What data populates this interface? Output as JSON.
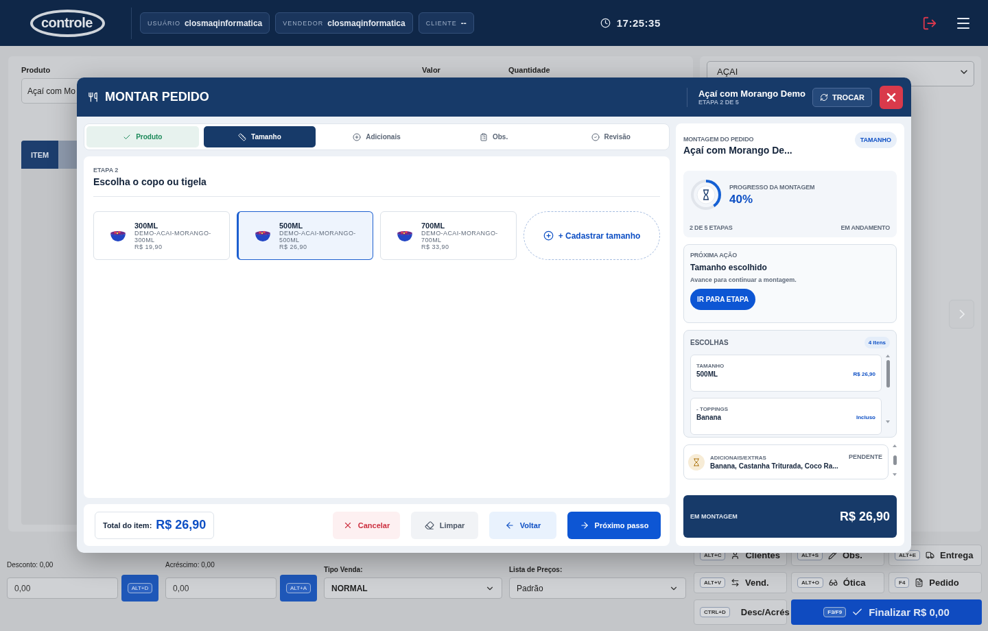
{
  "header": {
    "logo": "controle",
    "chips": [
      {
        "label": "USUÁRIO",
        "value": "closmaqinformatica"
      },
      {
        "label": "VENDEDOR",
        "value": "closmaqinformatica"
      },
      {
        "label": "CLIENTE",
        "value": "--"
      }
    ],
    "clock": "17:25:35"
  },
  "product_form": {
    "product_label": "Produto",
    "product_value": "Açaí com Mo",
    "price_label": "Valor",
    "quantity_label": "Quantidade",
    "table": {
      "columns": [
        "ITEM"
      ]
    }
  },
  "category_select": {
    "value": "AÇAI"
  },
  "bottom": {
    "discount": {
      "label": "Desconto: 0,00",
      "value": "0,00",
      "shortcut": "ALT+D"
    },
    "surcharge": {
      "label": "Acréscimo: 0,00",
      "value": "0,00",
      "shortcut": "ALT+A"
    },
    "sale_type": {
      "label": "Tipo Venda:",
      "value": "NORMAL"
    },
    "price_list": {
      "label": "Lista de Preços:",
      "value": "Padrão"
    },
    "actions": [
      {
        "key": "ALT+C",
        "label": "Clientes",
        "kind": "normal"
      },
      {
        "key": "ALT+S",
        "label": "Obs.",
        "kind": "normal"
      },
      {
        "key": "ALT+E",
        "label": "Entrega",
        "kind": "normal"
      },
      {
        "key": "ALT+V",
        "label": "Vend.",
        "kind": "normal"
      },
      {
        "key": "ALT+O",
        "label": "Ótica",
        "kind": "normal"
      },
      {
        "key": "F4",
        "label": "Pedido",
        "kind": "normal"
      },
      {
        "key": "CTRL+D",
        "label": "Desc/Acrés",
        "kind": "normal"
      },
      {
        "key": "F3/F9",
        "label": "Finalizar R$ 0,00",
        "kind": "primary"
      }
    ]
  },
  "modal": {
    "title": "MONTAR PEDIDO",
    "product": "Açaí com Morango Demo",
    "step": "ETAPA 2 DE 5",
    "swap_button": "TROCAR",
    "tabs": [
      {
        "label": "Produto",
        "done": true,
        "selected": false
      },
      {
        "label": "Tamanho",
        "done": false,
        "selected": true
      },
      {
        "label": "Adicionais",
        "done": false,
        "selected": false
      },
      {
        "label": "Obs.",
        "done": false,
        "selected": false
      },
      {
        "label": "Revisão",
        "done": false,
        "selected": false
      }
    ],
    "step_label": "ETAPA 2",
    "step_title": "Escolha o copo ou tigela",
    "sizes": [
      {
        "name": "300ML",
        "code": "DEMO-ACAI-MORANGO-300ML",
        "price": "R$ 19,90",
        "selected": false
      },
      {
        "name": "500ML",
        "code": "DEMO-ACAI-MORANGO-500ML",
        "price": "R$ 26,90",
        "selected": true
      },
      {
        "name": "700ML",
        "code": "DEMO-ACAI-MORANGO-700ML",
        "price": "R$ 33,90",
        "selected": false
      }
    ],
    "add_size": "+ Cadastrar tamanho",
    "total_label": "Total do item:",
    "total": "R$ 26,90",
    "buttons": [
      {
        "label": "Cancelar",
        "kind": "cancel"
      },
      {
        "label": "Limpar",
        "kind": "clear"
      },
      {
        "label": "Voltar",
        "kind": "back"
      },
      {
        "label": "Próximo passo",
        "kind": "next"
      }
    ],
    "summary": {
      "eyebrow": "MONTAGEM DO PEDIDO",
      "title": "Açaí com Morango De...",
      "badge": "TAMANHO",
      "progress": {
        "label": "PROGRESSO DA MONTAGEM",
        "percent": "40%",
        "level": 0.4,
        "steps": "2 DE 5 ETAPAS",
        "status": "EM ANDAMENTO"
      },
      "next_action": {
        "eyebrow": "PRÓXIMA AÇÃO",
        "title": "Tamanho escolhido",
        "text": "Avance para continuar a montagem.",
        "button": "IR PARA ETAPA"
      },
      "choices": {
        "title": "ESCOLHAS",
        "count": "4 itens",
        "items": [
          {
            "group": "TAMANHO",
            "value": "500ML",
            "price": "R$ 26,90"
          },
          {
            "group": "- TOPPINGS",
            "value": "Banana",
            "price": "Incluso"
          }
        ]
      },
      "pending": {
        "label": "ADICIONAIS/EXTRAS",
        "value": "Banana, Castanha Triturada, Coco Ra...",
        "status": "PENDENTE"
      },
      "total_label": "EM MONTAGEM",
      "total": "R$ 26,90"
    }
  }
}
